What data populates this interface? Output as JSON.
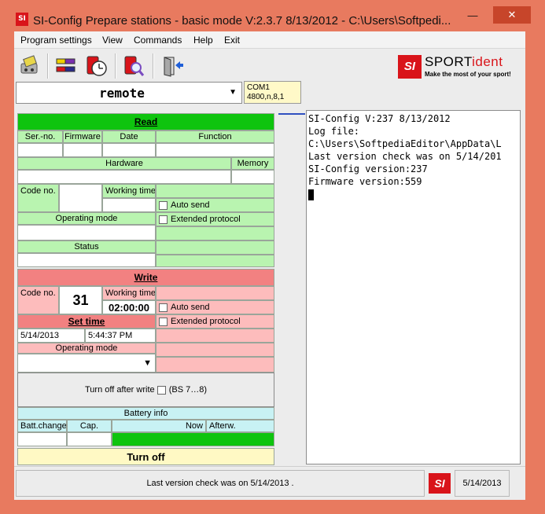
{
  "window": {
    "title": "SI-Config Prepare stations - basic mode V:2.3.7 8/13/2012 - C:\\Users\\Softpedi...",
    "min_glyph": "—",
    "max_glyph": "☐",
    "close_glyph": "✕",
    "app_icon_text": "SI"
  },
  "menu": {
    "items": [
      "Program settings",
      "View",
      "Commands",
      "Help",
      "Exit"
    ]
  },
  "toolbar": {
    "icons": [
      "card-reader-icon",
      "stations-icon",
      "clock-station-icon",
      "search-station-icon",
      "exit-door-icon"
    ]
  },
  "logo": {
    "box": "SI",
    "brand_part1": "SPORT",
    "brand_part2": "ident",
    "tagline": "Make the most of your sport!"
  },
  "mode": {
    "value": "remote",
    "arrow": "▼"
  },
  "com": {
    "port": "COM1",
    "settings": "4800,n,8,1"
  },
  "read": {
    "title": "Read",
    "col_serno": "Ser.-no.",
    "col_firmware": "Firmware",
    "col_date": "Date",
    "col_function": "Function",
    "hardware": "Hardware",
    "memory": "Memory",
    "code_no": "Code no.",
    "working_time": "Working time",
    "auto_send": "Auto send",
    "extended_protocol": "Extended protocol",
    "operating_mode": "Operating mode",
    "status": "Status"
  },
  "write": {
    "title": "Write",
    "code_no": "Code no.",
    "code_value": "31",
    "working_time": "Working time",
    "working_time_value": "02:00:00",
    "auto_send": "Auto send",
    "extended_protocol": "Extended protocol",
    "set_time": "Set time",
    "date_value": "5/14/2013",
    "time_value": "5:44:37 PM",
    "operating_mode": "Operating mode",
    "turn_off_after_write": "Turn off after write",
    "bs_range": "(BS 7…8)"
  },
  "battery": {
    "title": "Battery info",
    "batt_change": "Batt.change",
    "cap": "Cap.",
    "now": "Now",
    "afterw": "Afterw."
  },
  "turn_off": {
    "label": "Turn off"
  },
  "log": {
    "lines": [
      "SI-Config V:237 8/13/2012",
      "Log file:",
      "C:\\Users\\SoftpediaEditor\\AppData\\L",
      "Last version check was on 5/14/201",
      "SI-Config version:237",
      "Firmware version:559"
    ]
  },
  "status": {
    "message": "Last version check was on 5/14/2013 .",
    "icon_text": "SI",
    "date": "5/14/2013"
  },
  "colors": {
    "title_bar": "#e87a5f",
    "read_header": "#0ec40e",
    "read_body": "#b9f4b0",
    "write_header": "#f28181",
    "write_body": "#fdbcbc",
    "battery": "#c8f2f4",
    "turn_off": "#fff9c4",
    "brand_red": "#d9141a"
  }
}
